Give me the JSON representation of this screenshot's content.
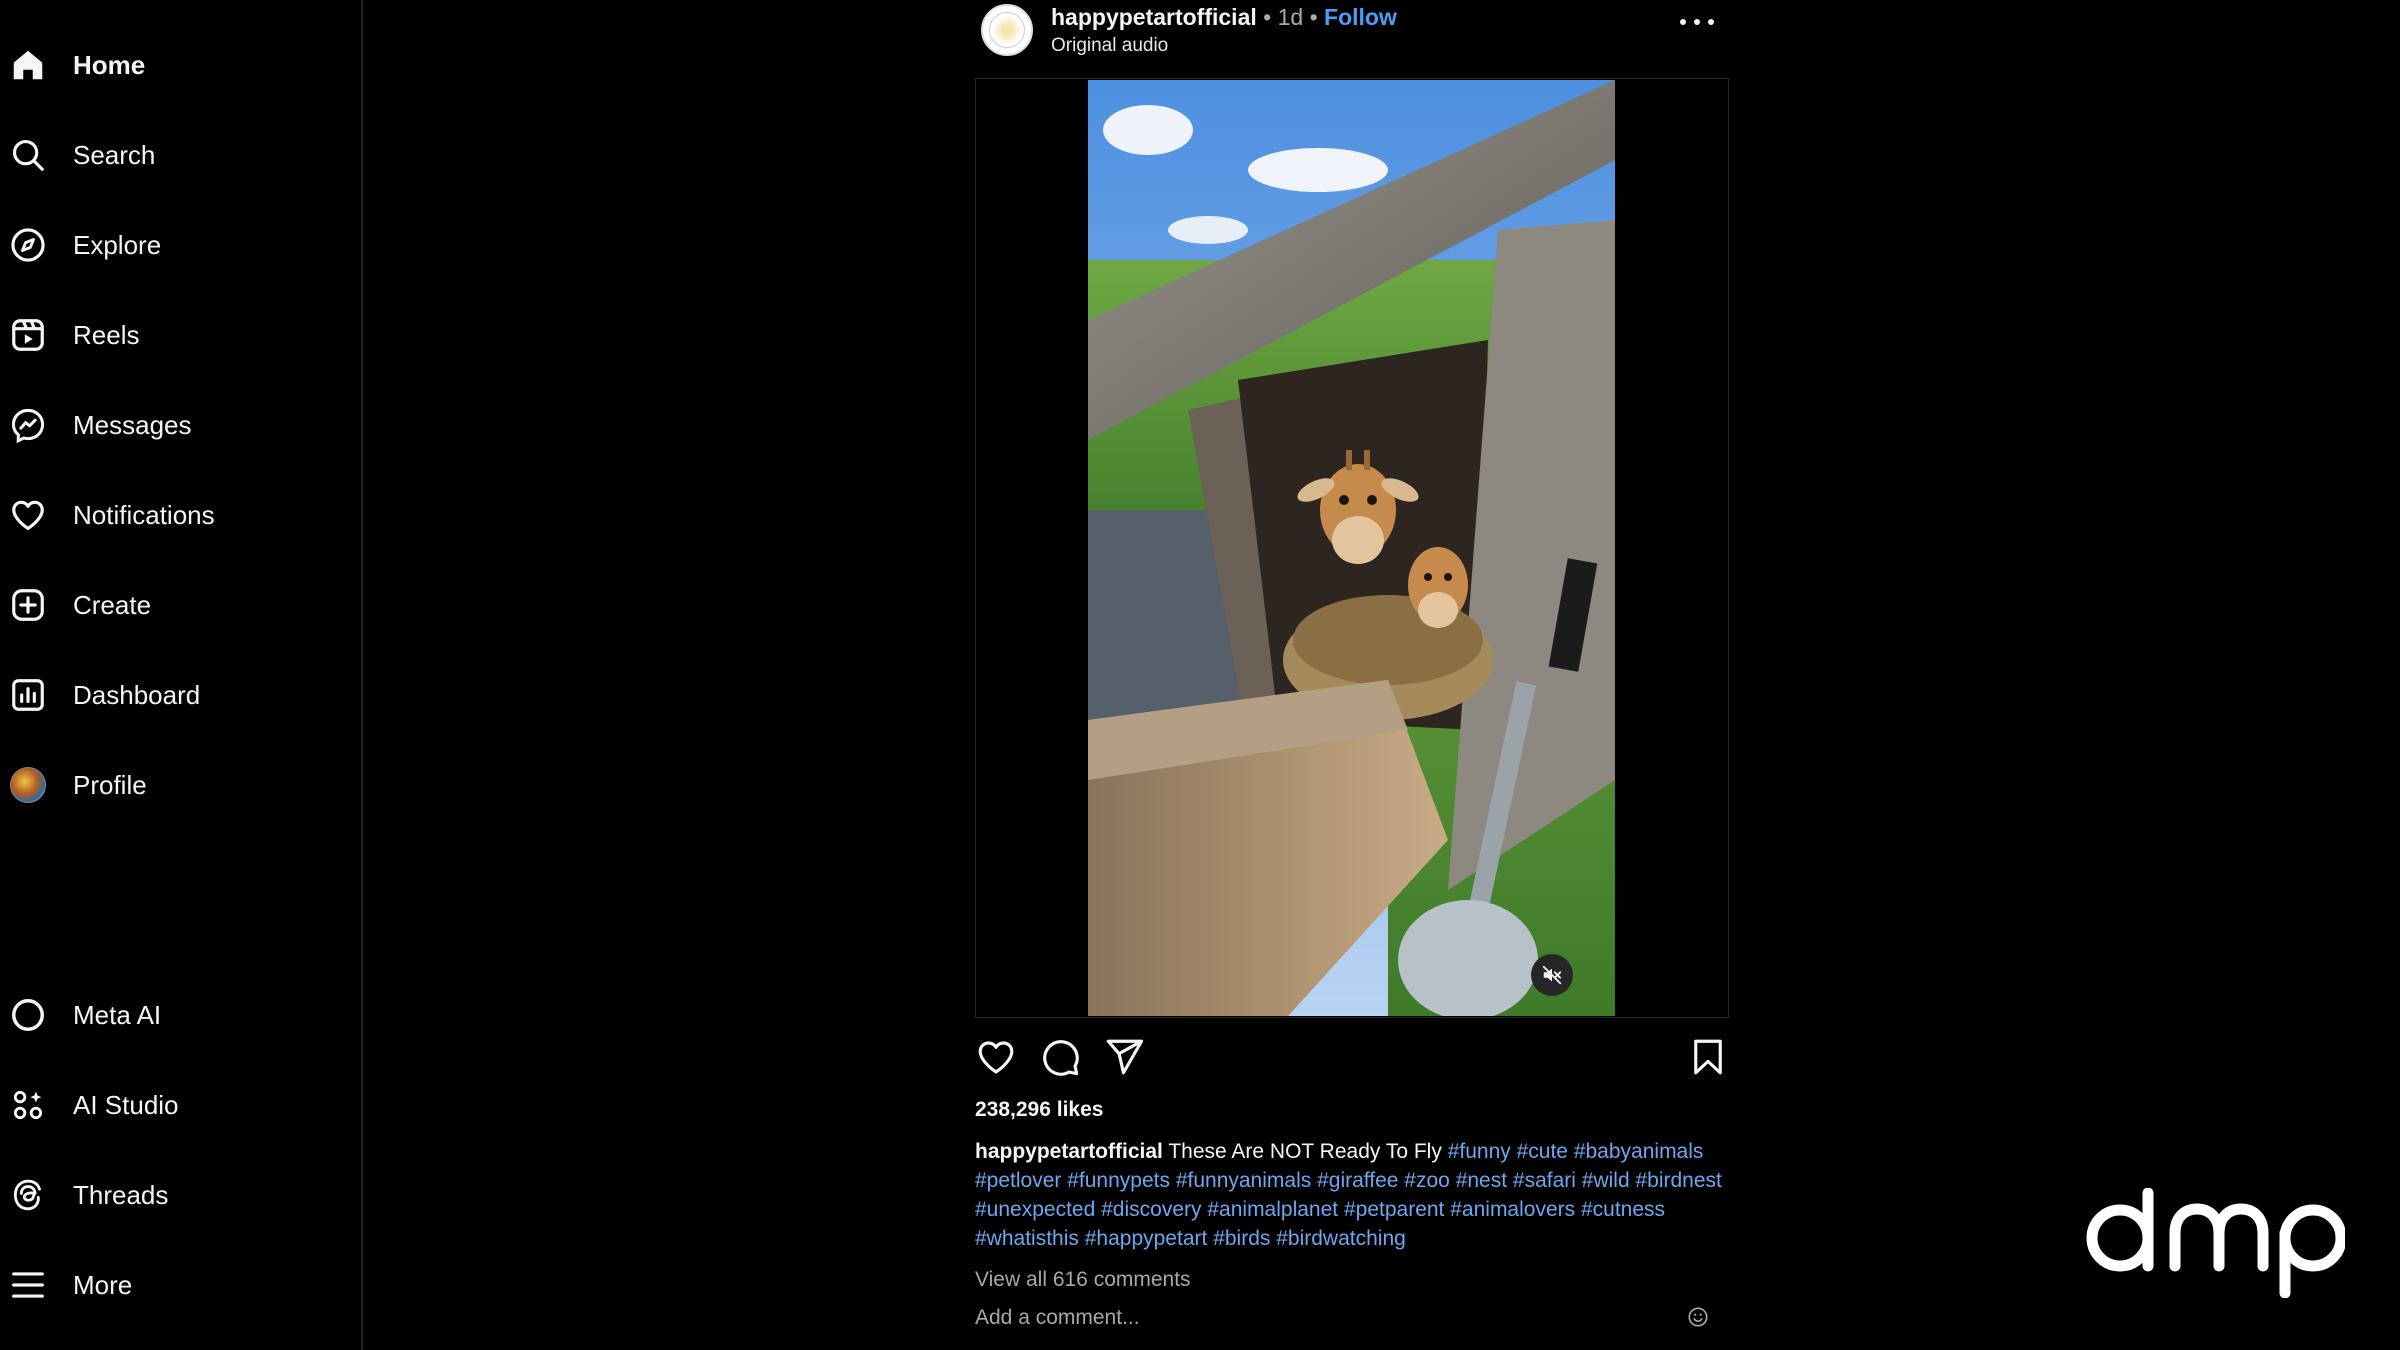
{
  "sidebar": {
    "items": [
      {
        "label": "Home",
        "icon": "home-icon"
      },
      {
        "label": "Search",
        "icon": "search-icon"
      },
      {
        "label": "Explore",
        "icon": "compass-icon"
      },
      {
        "label": "Reels",
        "icon": "reels-icon"
      },
      {
        "label": "Messages",
        "icon": "messenger-icon"
      },
      {
        "label": "Notifications",
        "icon": "heart-icon"
      },
      {
        "label": "Create",
        "icon": "plus-square-icon"
      },
      {
        "label": "Dashboard",
        "icon": "chart-icon"
      },
      {
        "label": "Profile",
        "icon": "avatar"
      }
    ],
    "bottom_items": [
      {
        "label": "Meta AI",
        "icon": "meta-ai-icon"
      },
      {
        "label": "AI Studio",
        "icon": "ai-studio-icon"
      },
      {
        "label": "Threads",
        "icon": "threads-icon"
      },
      {
        "label": "More",
        "icon": "menu-icon"
      }
    ]
  },
  "post": {
    "username": "happypetartofficial",
    "separator": "•",
    "time": "1d",
    "follow_label": "Follow",
    "audio": "Original audio",
    "likes": "238,296 likes",
    "caption_text": "These Are NOT Ready To Fly",
    "hashtags": [
      "#funny",
      "#cute",
      "#babyanimals",
      "#petlover",
      "#funnypets",
      "#funnyanimals",
      "#giraffee",
      "#zoo",
      "#nest",
      "#safari",
      "#wild",
      "#birdnest",
      "#unexpected",
      "#discovery",
      "#animalplanet",
      "#petparent",
      "#animalovers",
      "#cutness",
      "#whatisthis",
      "#happypetart",
      "#birds",
      "#birdwatching"
    ],
    "view_comments": "View all 616 comments",
    "add_comment_placeholder": "Add a comment..."
  },
  "watermark": {
    "text": "dmp"
  },
  "colors": {
    "link": "#4a9ff5",
    "hashtag": "#6ba8f0",
    "background": "#000000"
  }
}
